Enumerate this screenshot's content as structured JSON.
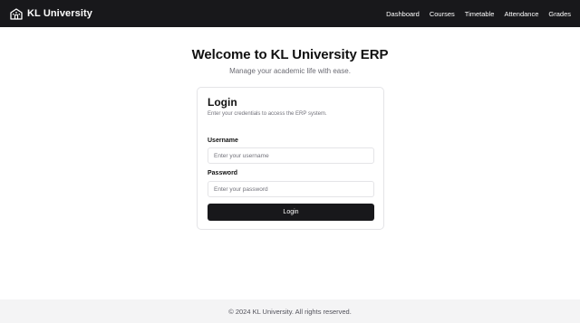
{
  "header": {
    "brand": "KL University",
    "brand_icon": "school-building-icon",
    "nav": [
      "Dashboard",
      "Courses",
      "Timetable",
      "Attendance",
      "Grades"
    ]
  },
  "hero": {
    "title": "Welcome to KL University ERP",
    "subtitle": "Manage your academic life with ease."
  },
  "login": {
    "title": "Login",
    "description": "Enter your credentials to access the ERP system.",
    "username_label": "Username",
    "username_placeholder": "Enter your username",
    "password_label": "Password",
    "password_placeholder": "Enter your password",
    "submit_label": "Login"
  },
  "footer": {
    "text": "© 2024 KL University. All rights reserved."
  },
  "colors": {
    "header_bg": "#18181b",
    "button_bg": "#18181b",
    "footer_bg": "#f4f4f5"
  }
}
